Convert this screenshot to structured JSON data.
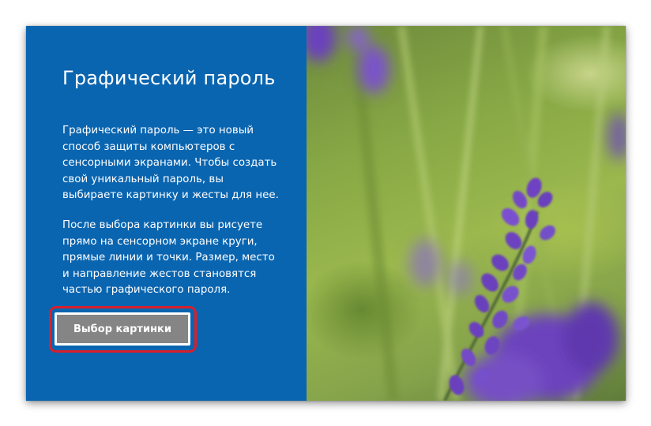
{
  "dialog": {
    "title": "Графический пароль",
    "paragraph1_lines": [
      "Графический пароль — это новый",
      "способ защиты компьютеров с",
      "сенсорными экранами. Чтобы создать",
      "свой уникальный пароль, вы",
      "выбираете картинку и жесты для нее."
    ],
    "paragraph2_lines": [
      "После выбора картинки вы рисуете",
      "прямо на сенсорном экране круги,",
      "прямые линии и точки. Размер, место",
      "и направление жестов становятся",
      "частью графического пароля."
    ],
    "choose_picture_button": "Выбор картинки"
  },
  "colors": {
    "panel_blue": "#0a65b0",
    "button_gray": "#858585",
    "highlight_red": "#d81f2a",
    "lavender": "#6a42b8",
    "grass_green": "#8fae47"
  },
  "image": {
    "subject": "lavender flower on green background"
  }
}
